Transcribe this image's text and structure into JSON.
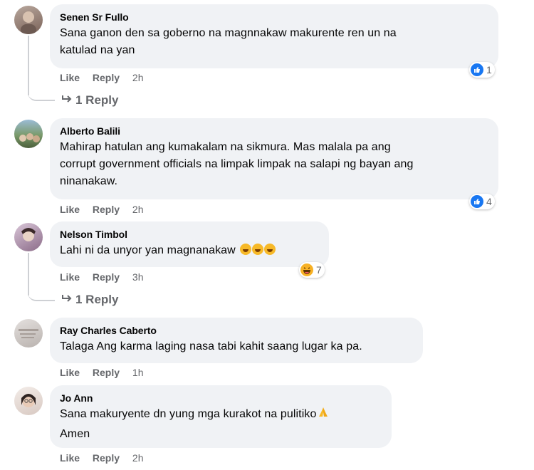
{
  "comments": [
    {
      "author": "Senen Sr Fullo",
      "lines": [
        "Sana ganon den sa goberno na magnnakaw makurente ren un na",
        "katulad na yan"
      ],
      "like": "Like",
      "reply": "Reply",
      "time": "2h",
      "reaction_count": "1",
      "replies_link": "1 Reply"
    },
    {
      "author": "Alberto Balili",
      "lines": [
        "Mahirap hatulan ang kumakalam na sikmura. Mas malala pa ang",
        "corrupt government officials na limpak limpak na salapi ng bayan ang",
        "ninanakaw."
      ],
      "like": "Like",
      "reply": "Reply",
      "time": "2h",
      "reaction_count": "4"
    },
    {
      "author": "Nelson Timbol",
      "lines": [
        "Lahi ni da unyor yan magnanakaw"
      ],
      "emoji": "🤣🤣🤣",
      "like": "Like",
      "reply": "Reply",
      "time": "3h",
      "reaction_count": "7",
      "replies_link": "1 Reply"
    },
    {
      "author": "Ray Charles Caberto",
      "lines": [
        "Talaga Ang karma laging nasa tabi kahit saang lugar ka pa."
      ],
      "like": "Like",
      "reply": "Reply",
      "time": "1h"
    },
    {
      "author": "Jo Ann",
      "lines": [
        "Sana makuryente dn yung mga kurakot na pulitiko",
        "Amen"
      ],
      "emoji": "🙏",
      "like": "Like",
      "reply": "Reply",
      "time": "2h"
    }
  ],
  "icons": {
    "reply_arrow": "reply-arrow-icon",
    "like_reaction": "like-reaction-icon",
    "haha_reaction": "haha-reaction-icon"
  },
  "colors": {
    "bubble": "#f0f2f5",
    "secondary_text": "#65676b",
    "like_blue": "#1877f2"
  }
}
